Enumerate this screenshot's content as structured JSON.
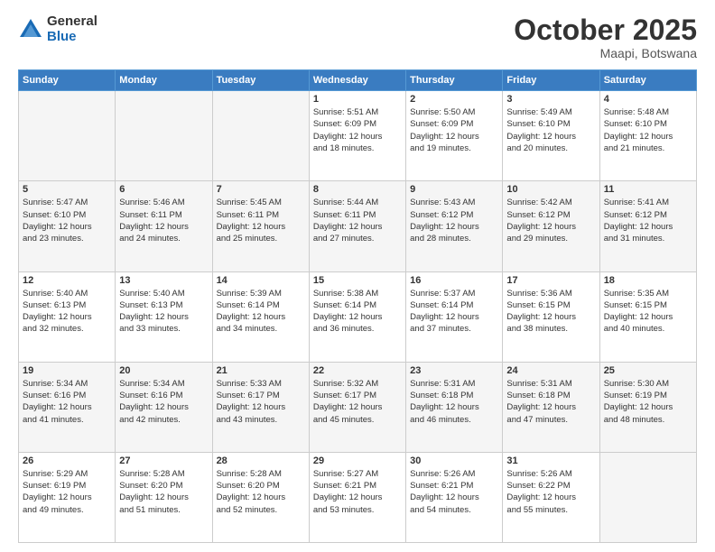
{
  "logo": {
    "general": "General",
    "blue": "Blue"
  },
  "title": "October 2025",
  "location": "Maapi, Botswana",
  "days_of_week": [
    "Sunday",
    "Monday",
    "Tuesday",
    "Wednesday",
    "Thursday",
    "Friday",
    "Saturday"
  ],
  "weeks": [
    [
      {
        "day": "",
        "empty": true
      },
      {
        "day": "",
        "empty": true
      },
      {
        "day": "",
        "empty": true
      },
      {
        "day": "1",
        "sunrise": "5:51 AM",
        "sunset": "6:09 PM",
        "daylight": "12 hours and 18 minutes."
      },
      {
        "day": "2",
        "sunrise": "5:50 AM",
        "sunset": "6:09 PM",
        "daylight": "12 hours and 19 minutes."
      },
      {
        "day": "3",
        "sunrise": "5:49 AM",
        "sunset": "6:10 PM",
        "daylight": "12 hours and 20 minutes."
      },
      {
        "day": "4",
        "sunrise": "5:48 AM",
        "sunset": "6:10 PM",
        "daylight": "12 hours and 21 minutes."
      }
    ],
    [
      {
        "day": "5",
        "sunrise": "5:47 AM",
        "sunset": "6:10 PM",
        "daylight": "12 hours and 23 minutes."
      },
      {
        "day": "6",
        "sunrise": "5:46 AM",
        "sunset": "6:11 PM",
        "daylight": "12 hours and 24 minutes."
      },
      {
        "day": "7",
        "sunrise": "5:45 AM",
        "sunset": "6:11 PM",
        "daylight": "12 hours and 25 minutes."
      },
      {
        "day": "8",
        "sunrise": "5:44 AM",
        "sunset": "6:11 PM",
        "daylight": "12 hours and 27 minutes."
      },
      {
        "day": "9",
        "sunrise": "5:43 AM",
        "sunset": "6:12 PM",
        "daylight": "12 hours and 28 minutes."
      },
      {
        "day": "10",
        "sunrise": "5:42 AM",
        "sunset": "6:12 PM",
        "daylight": "12 hours and 29 minutes."
      },
      {
        "day": "11",
        "sunrise": "5:41 AM",
        "sunset": "6:12 PM",
        "daylight": "12 hours and 31 minutes."
      }
    ],
    [
      {
        "day": "12",
        "sunrise": "5:40 AM",
        "sunset": "6:13 PM",
        "daylight": "12 hours and 32 minutes."
      },
      {
        "day": "13",
        "sunrise": "5:40 AM",
        "sunset": "6:13 PM",
        "daylight": "12 hours and 33 minutes."
      },
      {
        "day": "14",
        "sunrise": "5:39 AM",
        "sunset": "6:14 PM",
        "daylight": "12 hours and 34 minutes."
      },
      {
        "day": "15",
        "sunrise": "5:38 AM",
        "sunset": "6:14 PM",
        "daylight": "12 hours and 36 minutes."
      },
      {
        "day": "16",
        "sunrise": "5:37 AM",
        "sunset": "6:14 PM",
        "daylight": "12 hours and 37 minutes."
      },
      {
        "day": "17",
        "sunrise": "5:36 AM",
        "sunset": "6:15 PM",
        "daylight": "12 hours and 38 minutes."
      },
      {
        "day": "18",
        "sunrise": "5:35 AM",
        "sunset": "6:15 PM",
        "daylight": "12 hours and 40 minutes."
      }
    ],
    [
      {
        "day": "19",
        "sunrise": "5:34 AM",
        "sunset": "6:16 PM",
        "daylight": "12 hours and 41 minutes."
      },
      {
        "day": "20",
        "sunrise": "5:34 AM",
        "sunset": "6:16 PM",
        "daylight": "12 hours and 42 minutes."
      },
      {
        "day": "21",
        "sunrise": "5:33 AM",
        "sunset": "6:17 PM",
        "daylight": "12 hours and 43 minutes."
      },
      {
        "day": "22",
        "sunrise": "5:32 AM",
        "sunset": "6:17 PM",
        "daylight": "12 hours and 45 minutes."
      },
      {
        "day": "23",
        "sunrise": "5:31 AM",
        "sunset": "6:18 PM",
        "daylight": "12 hours and 46 minutes."
      },
      {
        "day": "24",
        "sunrise": "5:31 AM",
        "sunset": "6:18 PM",
        "daylight": "12 hours and 47 minutes."
      },
      {
        "day": "25",
        "sunrise": "5:30 AM",
        "sunset": "6:19 PM",
        "daylight": "12 hours and 48 minutes."
      }
    ],
    [
      {
        "day": "26",
        "sunrise": "5:29 AM",
        "sunset": "6:19 PM",
        "daylight": "12 hours and 49 minutes."
      },
      {
        "day": "27",
        "sunrise": "5:28 AM",
        "sunset": "6:20 PM",
        "daylight": "12 hours and 51 minutes."
      },
      {
        "day": "28",
        "sunrise": "5:28 AM",
        "sunset": "6:20 PM",
        "daylight": "12 hours and 52 minutes."
      },
      {
        "day": "29",
        "sunrise": "5:27 AM",
        "sunset": "6:21 PM",
        "daylight": "12 hours and 53 minutes."
      },
      {
        "day": "30",
        "sunrise": "5:26 AM",
        "sunset": "6:21 PM",
        "daylight": "12 hours and 54 minutes."
      },
      {
        "day": "31",
        "sunrise": "5:26 AM",
        "sunset": "6:22 PM",
        "daylight": "12 hours and 55 minutes."
      },
      {
        "day": "",
        "empty": true
      }
    ]
  ],
  "labels": {
    "sunrise": "Sunrise:",
    "sunset": "Sunset:",
    "daylight": "Daylight:"
  }
}
